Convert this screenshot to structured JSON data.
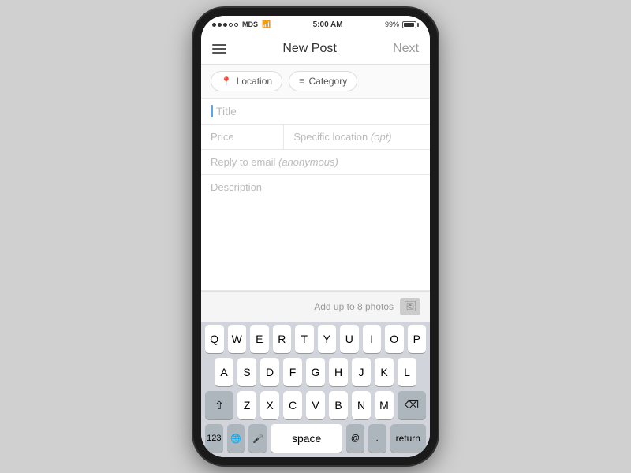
{
  "status_bar": {
    "carrier": "MDS",
    "time": "5:00 AM",
    "battery_pct": "99%"
  },
  "nav": {
    "title": "New Post",
    "next_label": "Next",
    "menu_label": "Menu"
  },
  "tags": {
    "location_label": "Location",
    "category_label": "Category"
  },
  "form": {
    "title_placeholder": "Title",
    "price_placeholder": "Price",
    "specific_location_placeholder": "Specific location",
    "specific_location_opt": "(opt)",
    "email_placeholder": "Reply to email",
    "email_anon": "(anonymous)",
    "description_placeholder": "Description",
    "photos_label": "Add up to 8 photos"
  },
  "keyboard": {
    "row1": [
      "Q",
      "W",
      "E",
      "R",
      "T",
      "Y",
      "U",
      "I",
      "O",
      "P"
    ],
    "row2": [
      "A",
      "S",
      "D",
      "F",
      "G",
      "H",
      "J",
      "K",
      "L"
    ],
    "row3": [
      "Z",
      "X",
      "C",
      "V",
      "B",
      "N",
      "M"
    ],
    "bottom": {
      "numbers": "123",
      "globe": "🌐",
      "mic": "🎤",
      "space": "space",
      "at": "@",
      "period": ".",
      "return": "return"
    }
  }
}
